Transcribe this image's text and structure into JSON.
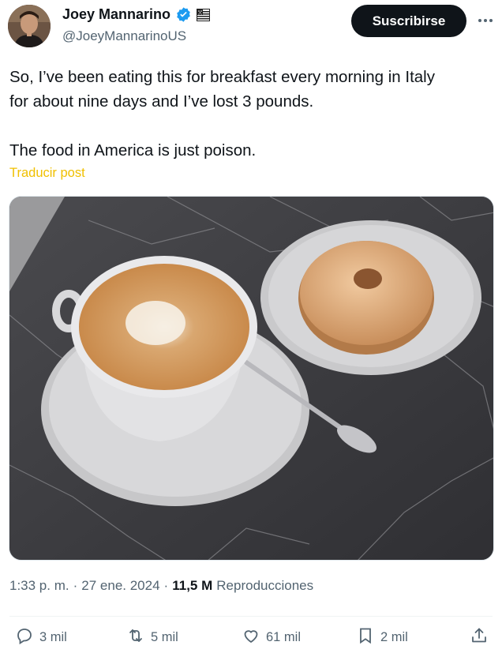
{
  "author": {
    "display_name": "Joey Mannarino",
    "handle": "@JoeyMannarinoUS",
    "verified_icon": "verified-badge-icon",
    "flag_icon": "us-flag-icon"
  },
  "header": {
    "subscribe_label": "Suscribirse",
    "more_icon": "more-options-icon"
  },
  "post": {
    "text_line1": "So, I’ve been eating this for breakfast every morning in Italy",
    "text_line2": "for about nine days and I’ve lost 3 pounds.",
    "text_line3": "The food in America is just poison.",
    "translate_label": "Traducir post",
    "photo_alt_icon": "breakfast-photo"
  },
  "meta": {
    "time": "1:33 p. m.",
    "sep1": "·",
    "date": "27 ene. 2024",
    "sep2": "·",
    "views_count": "11,5 M",
    "views_label": "Reproducciones"
  },
  "actions": {
    "replies": "3 mil",
    "reposts": "5 mil",
    "likes": "61 mil",
    "bookmarks": "2 mil"
  },
  "colors": {
    "accent_translate": "#f0c000",
    "button_bg": "#0f1419",
    "muted": "#536471",
    "verified": "#1d9bf0"
  }
}
